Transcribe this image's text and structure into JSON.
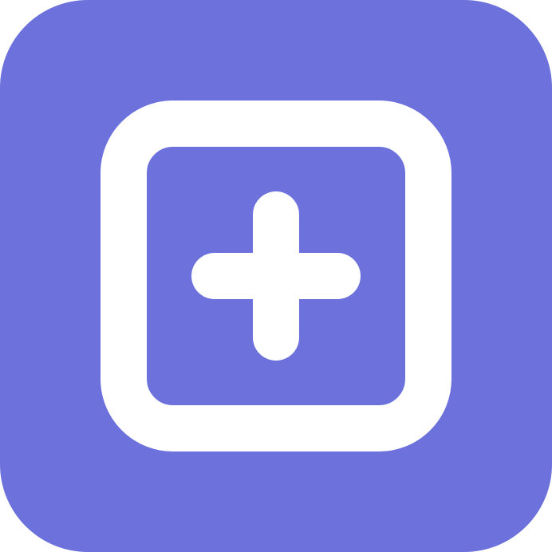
{
  "icon": {
    "name": "add-square-icon",
    "background_color": "#6c71db",
    "foreground_color": "#ffffff"
  }
}
